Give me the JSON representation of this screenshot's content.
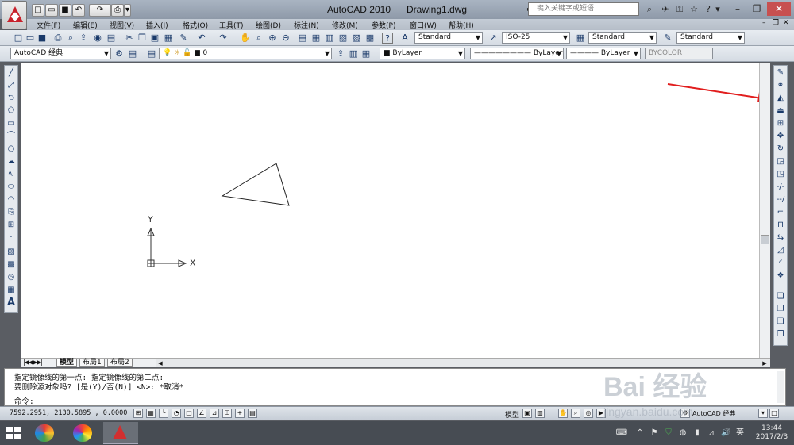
{
  "window": {
    "app_name": "AutoCAD 2010",
    "document": "Drawing1.dwg",
    "search_placeholder": "键入关键字或短语"
  },
  "menu": [
    "文件(F)",
    "编辑(E)",
    "视图(V)",
    "插入(I)",
    "格式(O)",
    "工具(T)",
    "绘图(D)",
    "标注(N)",
    "修改(M)",
    "参数(P)",
    "窗口(W)",
    "帮助(H)"
  ],
  "styles": {
    "text_style": "Standard",
    "dim_style": "ISO-25",
    "table_style": "Standard",
    "multileader_style": "Standard"
  },
  "workspace": "AutoCAD 经典",
  "layer": "0",
  "properties": {
    "color": "ByLayer",
    "linetype": "ByLayer",
    "lineweight": "ByLayer",
    "plotstyle": "BYCOLOR"
  },
  "ucs": {
    "x_label": "X",
    "y_label": "Y"
  },
  "layout_tabs": [
    "模型",
    "布局1",
    "布局2"
  ],
  "command": {
    "history_1": "指定镜像线的第一点: 指定镜像线的第二点:",
    "history_2": "要删除源对象吗? [是(Y)/否(N)] <N>: *取消*",
    "prompt": "命令:"
  },
  "status": {
    "coords": "7592.2951,  2130.5895 , 0.0000",
    "model_label": "模型",
    "workspace_label": "AutoCAD 经典"
  },
  "taskbar": {
    "time": "13:44",
    "date": "2017/2/3",
    "ime": "英"
  },
  "watermark": "Bai 经验",
  "watermark_url": "jingyan.baidu.com",
  "colors": {
    "accent_red": "#e11d1d",
    "title_bar": "#a9b4c2",
    "canvas": "#ffffff",
    "taskbar": "#474c53"
  }
}
